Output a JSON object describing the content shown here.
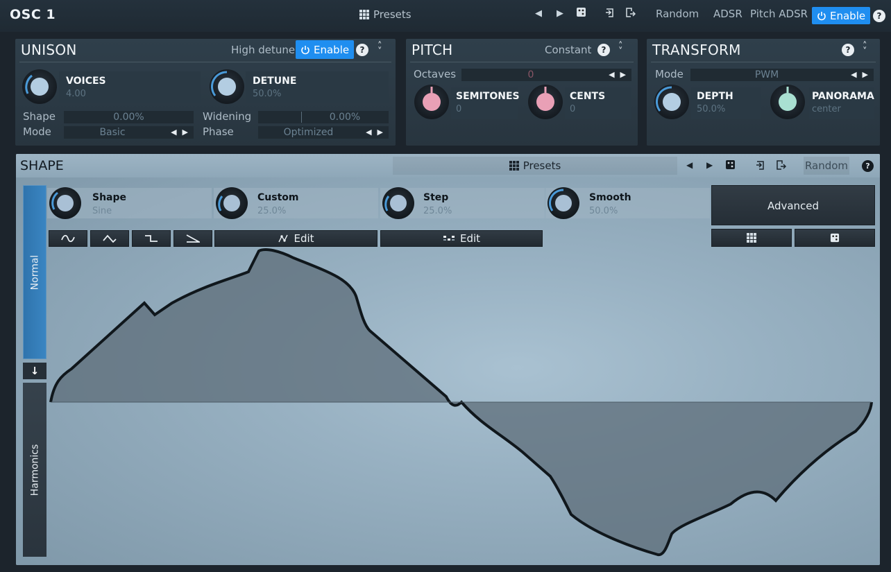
{
  "header": {
    "title": "OSC 1",
    "presets_label": "Presets",
    "random_label": "Random",
    "adsr_label": "ADSR",
    "pitch_adsr_label": "Pitch ADSR",
    "enable_label": "Enable",
    "help_label": "?"
  },
  "unison": {
    "title": "UNISON",
    "high_detune_label": "High detune",
    "enable_label": "Enable",
    "voices": {
      "name": "VOICES",
      "value": "4.00"
    },
    "detune": {
      "name": "DETUNE",
      "value": "50.0%"
    },
    "shape_label": "Shape",
    "shape_value": "0.00%",
    "mode_label": "Mode",
    "mode_value": "Basic",
    "widening_label": "Widening",
    "widening_value": "0.00%",
    "phase_label": "Phase",
    "phase_value": "Optimized"
  },
  "pitch": {
    "title": "PITCH",
    "mode_label": "Constant",
    "octaves_label": "Octaves",
    "octaves_value": "0",
    "semitones": {
      "name": "SEMITONES",
      "value": "0"
    },
    "cents": {
      "name": "CENTS",
      "value": "0"
    }
  },
  "transform": {
    "title": "TRANSFORM",
    "mode_label": "Mode",
    "mode_value": "PWM",
    "depth": {
      "name": "DEPTH",
      "value": "50.0%"
    },
    "panorama": {
      "name": "PANORAMA",
      "value": "center"
    }
  },
  "shape": {
    "title": "SHAPE",
    "presets_label": "Presets",
    "random_label": "Random",
    "side_normal": "Normal",
    "side_harmonics": "Harmonics",
    "knobs": [
      {
        "name": "Shape",
        "value": "Sine"
      },
      {
        "name": "Custom",
        "value": "25.0%"
      },
      {
        "name": "Step",
        "value": "25.0%"
      },
      {
        "name": "Smooth",
        "value": "50.0%"
      }
    ],
    "custom_edit_label": "Edit",
    "step_edit_label": "Edit",
    "advanced_label": "Advanced"
  },
  "colors": {
    "accent": "#1f8ef0",
    "pink_knob": "#e9a0b6",
    "mint_knob": "#a9e0d2",
    "blue_knob": "#b5cfe3"
  }
}
